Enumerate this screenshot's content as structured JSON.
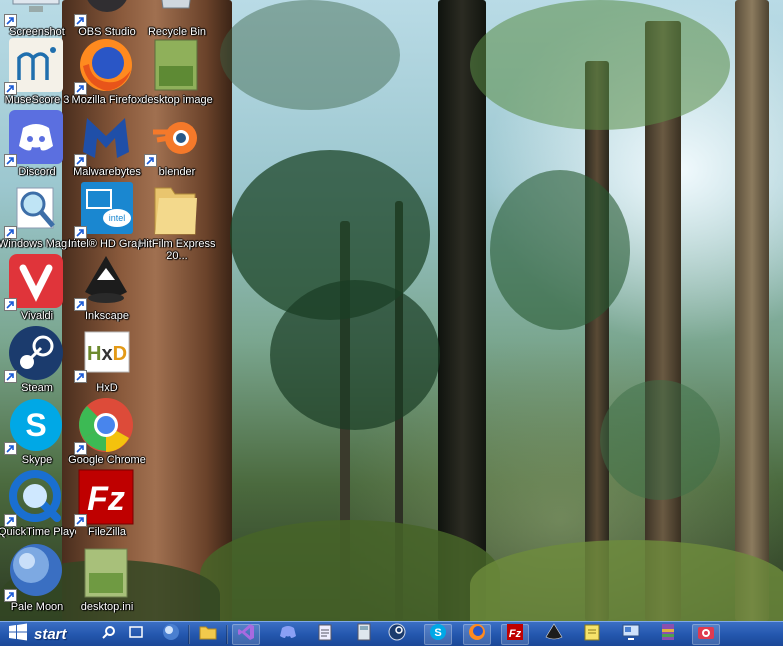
{
  "desktop": {
    "icons": [
      {
        "id": "screenshot",
        "label": "Screenshot",
        "icon": "screenshot-app-icon"
      },
      {
        "id": "obs",
        "label": "OBS Studio",
        "icon": "obs-icon"
      },
      {
        "id": "recycle",
        "label": "Recycle Bin",
        "icon": "recycle-bin-icon"
      },
      {
        "id": "musescore",
        "label": "MuseScore 3",
        "icon": "musescore-icon"
      },
      {
        "id": "firefox",
        "label": "Mozilla Firefox",
        "icon": "firefox-icon"
      },
      {
        "id": "desktopimg",
        "label": "desktop image",
        "icon": "image-file-icon"
      },
      {
        "id": "discord",
        "label": "Discord",
        "icon": "discord-icon"
      },
      {
        "id": "malwarebytes",
        "label": "Malwarebytes",
        "icon": "malwarebytes-icon"
      },
      {
        "id": "blender",
        "label": "blender",
        "icon": "blender-icon"
      },
      {
        "id": "magnifier",
        "label": "Windows Magnifier",
        "icon": "magnifier-icon"
      },
      {
        "id": "intel",
        "label": "Intel® HD Graphics",
        "icon": "intel-graphics-icon"
      },
      {
        "id": "hitfilm",
        "label": "HitFilm Express 20...",
        "icon": "folder-icon"
      },
      {
        "id": "vivaldi",
        "label": "Vivaldi",
        "icon": "vivaldi-icon"
      },
      {
        "id": "inkscape",
        "label": "Inkscape",
        "icon": "inkscape-icon"
      },
      {
        "id": "steam",
        "label": "Steam",
        "icon": "steam-icon"
      },
      {
        "id": "hxd",
        "label": "HxD",
        "icon": "hxd-icon"
      },
      {
        "id": "skype",
        "label": "Skype",
        "icon": "skype-icon"
      },
      {
        "id": "chrome",
        "label": "Google Chrome",
        "icon": "chrome-icon"
      },
      {
        "id": "quicktime",
        "label": "QuickTime Player",
        "icon": "quicktime-icon"
      },
      {
        "id": "filezilla",
        "label": "FileZilla",
        "icon": "filezilla-icon"
      },
      {
        "id": "palemoon",
        "label": "Pale Moon",
        "icon": "pale-moon-icon"
      },
      {
        "id": "desktopini",
        "label": "desktop.ini",
        "icon": "ini-file-icon"
      }
    ]
  },
  "taskbar": {
    "start_label": "start",
    "start_icon": "windows-logo-icon",
    "buttons": [
      {
        "id": "search",
        "icon": "search-icon"
      },
      {
        "id": "taskview",
        "icon": "task-view-icon"
      },
      {
        "id": "palemoon",
        "icon": "pale-moon-icon"
      },
      {
        "id": "explorer",
        "icon": "file-explorer-icon"
      },
      {
        "id": "visualstudio",
        "icon": "visual-studio-icon"
      },
      {
        "id": "discord",
        "icon": "discord-icon"
      },
      {
        "id": "notepad",
        "icon": "notepad-icon"
      },
      {
        "id": "calculator",
        "icon": "calculator-icon"
      },
      {
        "id": "steam",
        "icon": "steam-icon"
      },
      {
        "id": "skype",
        "icon": "skype-icon"
      },
      {
        "id": "firefox",
        "icon": "firefox-icon"
      },
      {
        "id": "filezilla",
        "icon": "filezilla-icon"
      },
      {
        "id": "inkscape",
        "icon": "inkscape-icon"
      },
      {
        "id": "notes",
        "icon": "sticky-notes-icon"
      },
      {
        "id": "remote",
        "icon": "remote-desktop-icon"
      },
      {
        "id": "winrar",
        "icon": "archive-icon"
      },
      {
        "id": "camera",
        "icon": "camera-icon"
      }
    ]
  },
  "colors": {
    "taskbar": "#2356ad",
    "icon_label_text": "#ffffff"
  }
}
